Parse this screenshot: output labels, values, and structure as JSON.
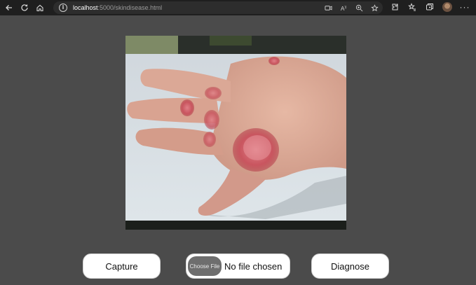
{
  "browser": {
    "url_host": "localhost",
    "url_path": ":5000/skindisease.html",
    "icons": {
      "back": "back-arrow-icon",
      "refresh": "refresh-icon",
      "home": "home-icon",
      "info": "info-icon",
      "address_bar": [
        "video-icon",
        "read-aloud-icon",
        "zoom-icon",
        "favorite-icon"
      ],
      "toolbar": [
        "extensions-icon",
        "favorites-icon",
        "collections-icon",
        "profile-avatar",
        "more-icon"
      ]
    }
  },
  "preview": {
    "image": "hand with red skin lesions"
  },
  "controls": {
    "capture_label": "Capture",
    "choose_file_label": "Choose File",
    "file_status": "No file chosen",
    "diagnose_label": "Diagnose"
  },
  "colors": {
    "page_background": "#4b4b4b",
    "button_background": "#ffffff",
    "choose_button": "#6e6e6e"
  }
}
